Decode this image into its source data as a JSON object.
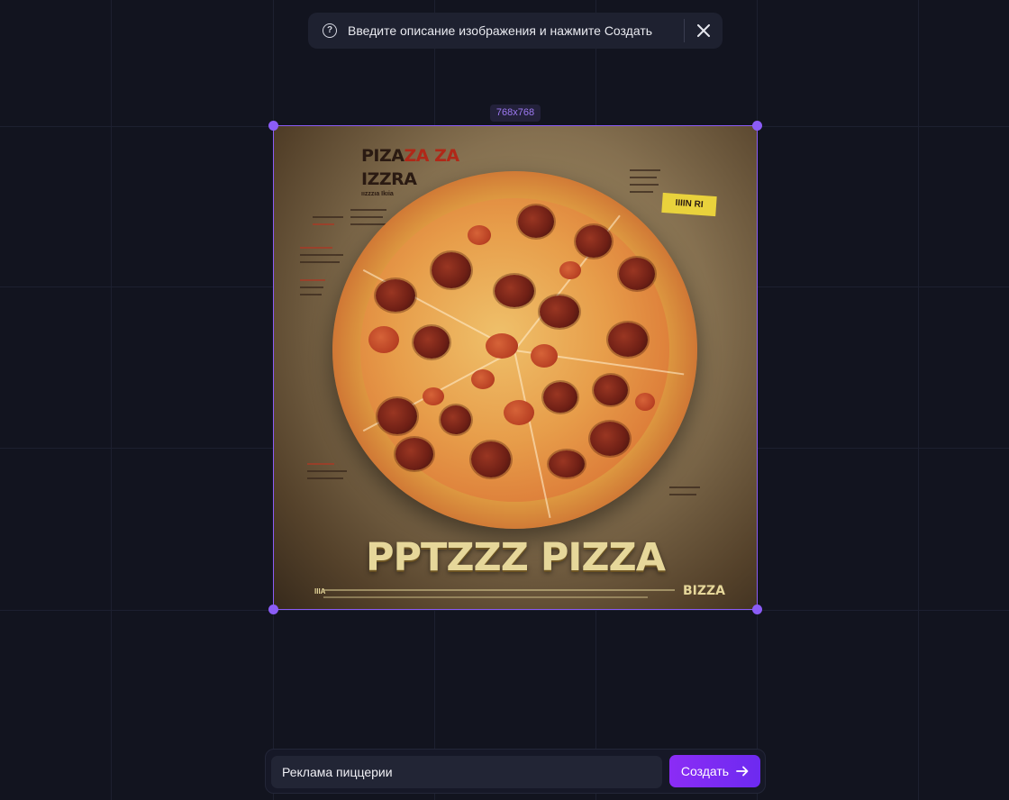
{
  "hint": {
    "help_icon": "question-circle-icon",
    "text": "Введите описание изображения и нажмите Создать",
    "close_icon": "close-icon"
  },
  "canvas": {
    "dimensions_label": "768x768",
    "image": {
      "headline_line1_dark": "PIZA",
      "headline_line1_red": "ZA ZA",
      "headline_line2": "IZZRA",
      "headline_line3": "ıızzzıa Ikıia",
      "tag": "IIIIN RI",
      "big_title": "PPTZZZ PIZZA",
      "brand_bottom_right": "BIZZA",
      "brand_bottom_left": "IIIA"
    },
    "accent_color": "#8b5cf6"
  },
  "prompt_bar": {
    "input_value": "Реклама пиццерии",
    "submit_label": "Создать",
    "submit_icon": "arrow-right-icon",
    "button_color": "#7c2af2"
  }
}
